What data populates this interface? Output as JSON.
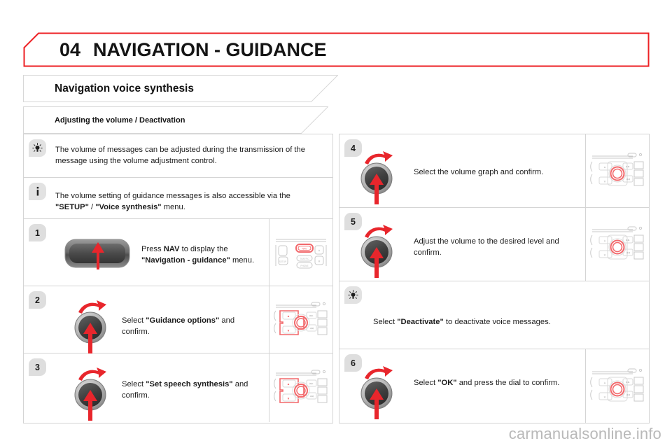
{
  "header": {
    "chapter_number": "04",
    "chapter_title": "NAVIGATION - GUIDANCE",
    "accent_color": "#ed2024"
  },
  "banners": {
    "main_title": "Navigation voice synthesis",
    "sub_title": "Adjusting the volume / Deactivation"
  },
  "left_column": {
    "tips": [
      {
        "icon": "lightbulb-icon",
        "text": "The volume of messages can be adjusted during the transmission of the message using the volume adjustment control."
      },
      {
        "icon": "info-icon",
        "text_before": "The volume setting of guidance messages is also accessible via the ",
        "bold_1": "\"SETUP\"",
        "text_mid": " / ",
        "bold_2": "\"Voice synthesis\"",
        "text_after": " menu."
      }
    ],
    "steps": [
      {
        "number": "1",
        "control": "nav-button",
        "text_before": "Press ",
        "bold_1": "NAV",
        "text_mid": " to display the ",
        "bold_2": "\"Navigation - guidance\"",
        "text_after": " menu.",
        "thumb": "dashboard-nav-button-highlight"
      },
      {
        "number": "2",
        "control": "rotary-dial",
        "text_before": "Select ",
        "bold_1": "\"Guidance options\"",
        "text_after": " and confirm.",
        "thumb": "dashboard-dial-arrows-highlight"
      },
      {
        "number": "3",
        "control": "rotary-dial",
        "text_before": "Select ",
        "bold_1": "\"Set speech synthesis\"",
        "text_after": " and confirm.",
        "thumb": "dashboard-dial-arrows-highlight"
      }
    ]
  },
  "right_column": {
    "steps": [
      {
        "number": "4",
        "control": "rotary-dial",
        "text_plain": "Select the volume graph and confirm.",
        "thumb": "dashboard-dial-highlight"
      },
      {
        "number": "5",
        "control": "rotary-dial",
        "text_plain": "Adjust the volume to the desired level and confirm.",
        "thumb": "dashboard-dial-highlight"
      }
    ],
    "tip": {
      "icon": "lightbulb-icon",
      "text_before": "Select ",
      "bold_1": "\"Deactivate\"",
      "text_after": " to deactivate voice messages."
    },
    "last_step": {
      "number": "6",
      "control": "rotary-dial",
      "text_before": "Select ",
      "bold_1": "\"OK\"",
      "text_after": " and press the dial to confirm.",
      "thumb": "dashboard-dial-highlight"
    }
  },
  "footer": {
    "watermark": "carmanualsonline.info"
  }
}
